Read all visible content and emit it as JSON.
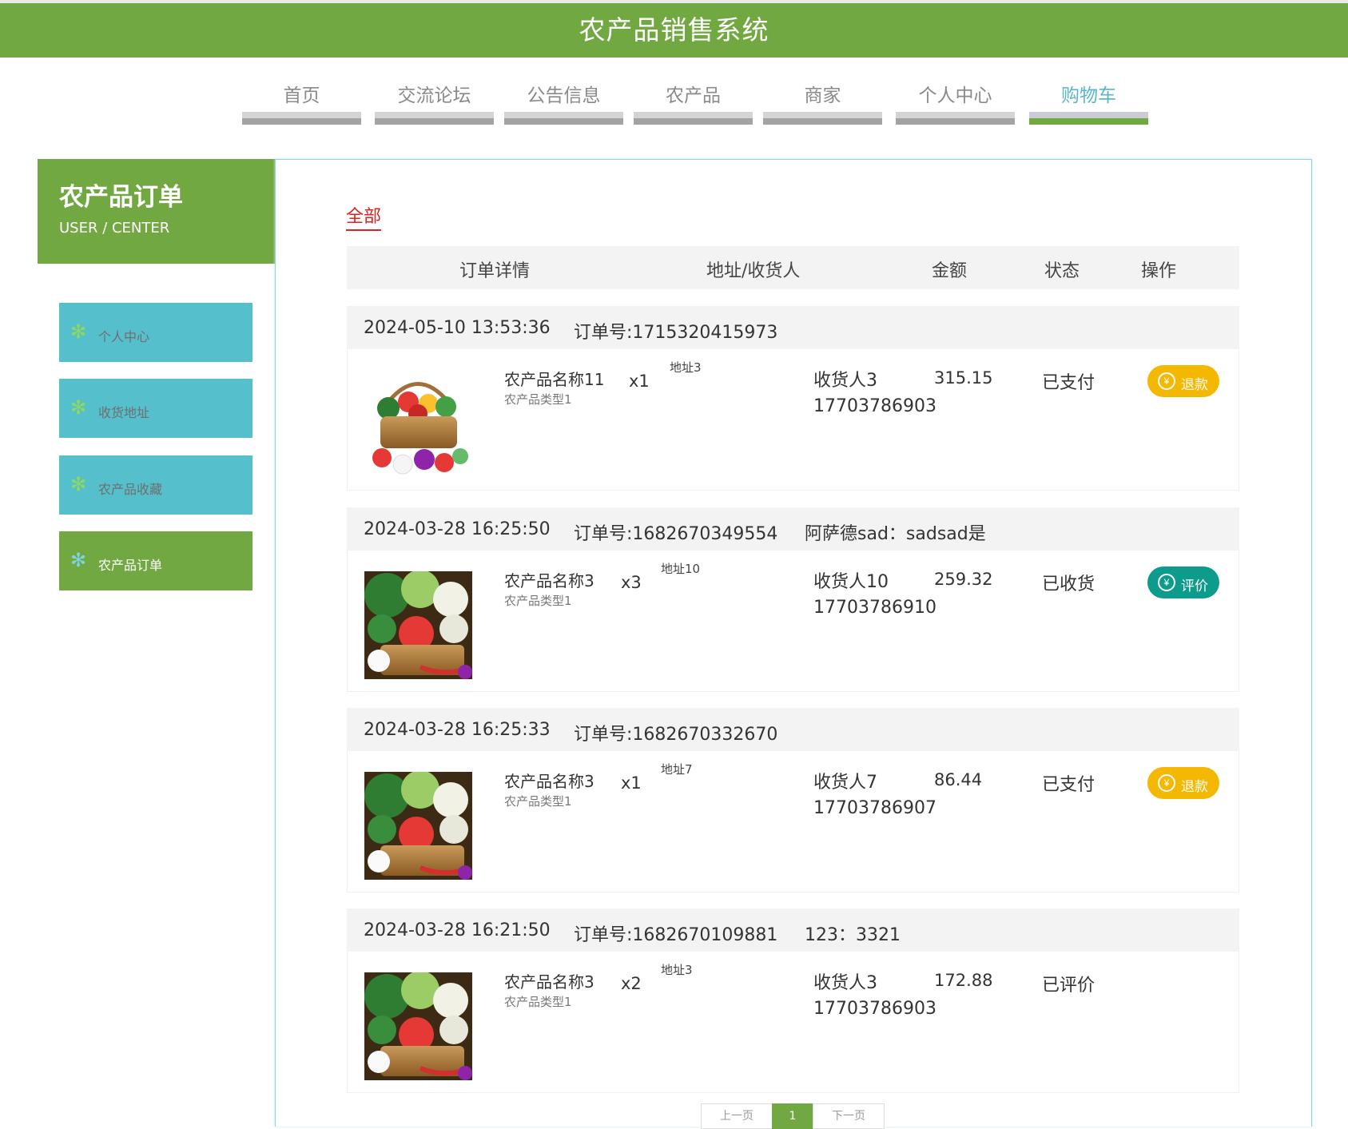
{
  "header": {
    "title": "农产品销售系统"
  },
  "nav": {
    "items": [
      {
        "label": "首页"
      },
      {
        "label": "交流论坛"
      },
      {
        "label": "公告信息"
      },
      {
        "label": "农产品"
      },
      {
        "label": "商家"
      },
      {
        "label": "个人中心"
      },
      {
        "label": "购物车"
      }
    ],
    "active": "购物车"
  },
  "sidebar": {
    "title": "农产品订单",
    "subtitle": "USER / CENTER",
    "items": [
      {
        "label": "个人中心"
      },
      {
        "label": "收货地址"
      },
      {
        "label": "农产品收藏"
      },
      {
        "label": "农产品订单"
      }
    ],
    "active": "农产品订单"
  },
  "main": {
    "tab_all": "全部",
    "columns": [
      "订单详情",
      "地址/收货人",
      "金额",
      "状态",
      "操作"
    ],
    "orders": [
      {
        "time": "2024-05-10 13:53:36",
        "order_no": "订单号:1715320415973",
        "note": "",
        "product_name": "农产品名称11",
        "product_type": "农产品类型1",
        "qty": "x1",
        "address": "地址3",
        "receiver": "收货人3",
        "phone": "17703786903",
        "amount": "315.15",
        "status": "已支付",
        "action": "退款"
      },
      {
        "time": "2024-03-28 16:25:50",
        "order_no": "订单号:1682670349554",
        "note": "阿萨德sad：sadsad是",
        "product_name": "农产品名称3",
        "product_type": "农产品类型1",
        "qty": "x3",
        "address": "地址10",
        "receiver": "收货人10",
        "phone": "17703786910",
        "amount": "259.32",
        "status": "已收货",
        "action": "评价"
      },
      {
        "time": "2024-03-28 16:25:33",
        "order_no": "订单号:1682670332670",
        "note": "",
        "product_name": "农产品名称3",
        "product_type": "农产品类型1",
        "qty": "x1",
        "address": "地址7",
        "receiver": "收货人7",
        "phone": "17703786907",
        "amount": "86.44",
        "status": "已支付",
        "action": "退款"
      },
      {
        "time": "2024-03-28 16:21:50",
        "order_no": "订单号:1682670109881",
        "note": "123：3321",
        "product_name": "农产品名称3",
        "product_type": "农产品类型1",
        "qty": "x2",
        "address": "地址3",
        "receiver": "收货人3",
        "phone": "17703786903",
        "amount": "172.88",
        "status": "已评价",
        "action": ""
      }
    ]
  },
  "pagination": {
    "prev": "上一页",
    "current": "1",
    "next": "下一页"
  },
  "colors": {
    "brand_green": "#72a842",
    "teal": "#55bfcb",
    "refund_yellow": "#f5b800",
    "review_teal": "#0d9b8c",
    "active_red": "#dd2222"
  }
}
